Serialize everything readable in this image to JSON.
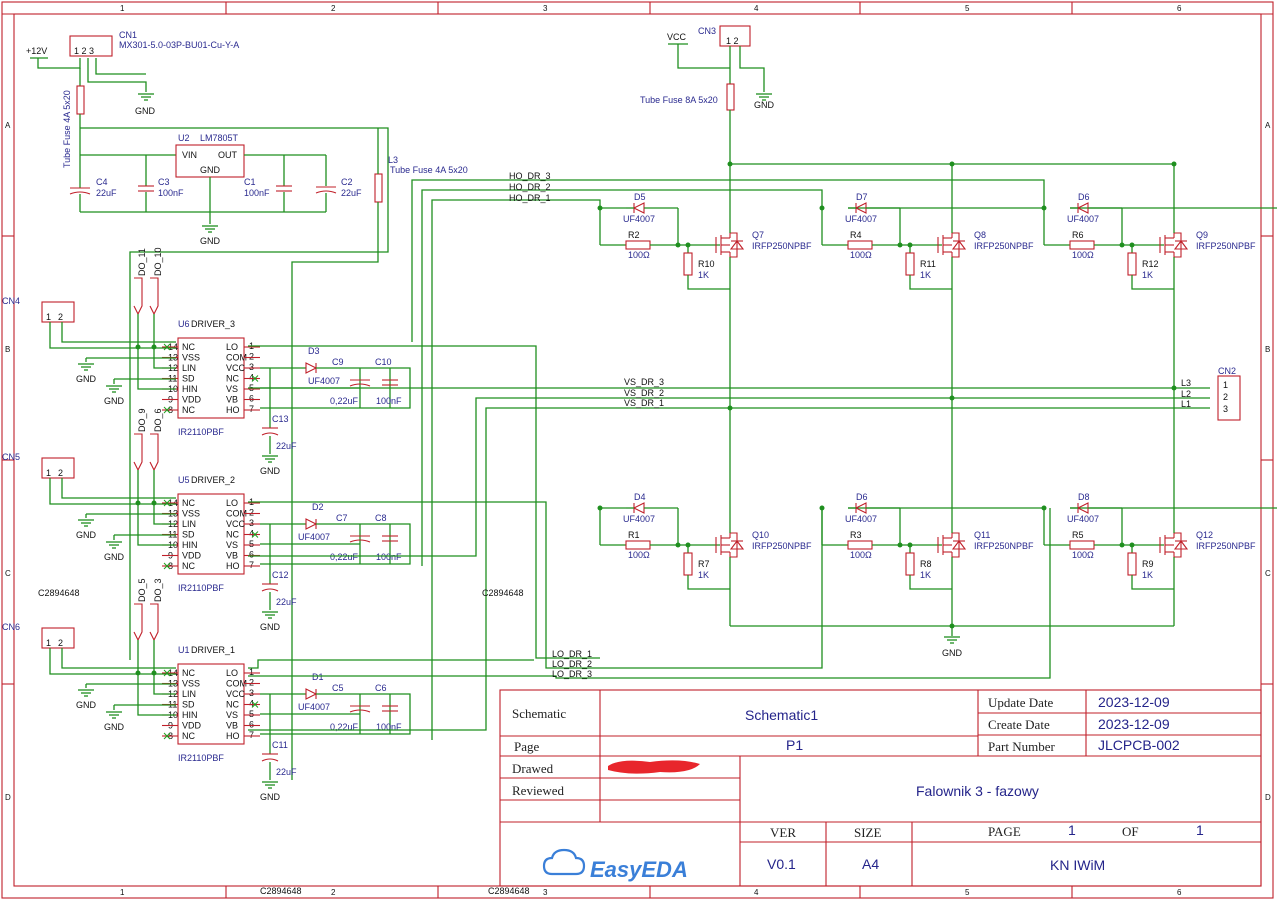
{
  "frame": {
    "cols": [
      "1",
      "2",
      "3",
      "4",
      "5",
      "6"
    ],
    "rows": [
      "A",
      "B",
      "C",
      "D"
    ]
  },
  "title_block": {
    "schematic_label": "Schematic",
    "schematic_name": "Schematic1",
    "page_label": "Page",
    "page_value": "P1",
    "update_date_label": "Update Date",
    "update_date": "2023-12-09",
    "create_date_label": "Create Date",
    "create_date": "2023-12-09",
    "part_number_label": "Part Number",
    "part_number": "JLCPCB-002",
    "drawed_label": "Drawed",
    "reviewed_label": "Reviewed",
    "project_title": "Falownik 3 - fazowy",
    "ver_label": "VER",
    "size_label": "SIZE",
    "page_hdr_label": "PAGE",
    "of_label": "OF",
    "page_num": "1",
    "page_total": "1",
    "ver_value": "V0.1",
    "size_value": "A4",
    "company": "KN IWiM",
    "logo_text": "EasyEDA"
  },
  "power": {
    "cn1": "CN1",
    "cn1_part": "MX301-5.0-03P-BU01-Cu-Y-A",
    "plus12": "+12V",
    "vcc": "VCC",
    "cn3": "CN3",
    "gnd": "GND",
    "fuse_main": "Tube Fuse 8A 5x20",
    "fuse_12v": "Tube Fuse 4A 5x20",
    "fuse_l3": "Tube Fuse 4A 5x20",
    "l3": "L3",
    "u2": "U2",
    "u2_part": "LM7805T",
    "vin": "VIN",
    "out": "OUT",
    "gnd_pin": "GND",
    "c4": "C4",
    "c4_val": "22uF",
    "c3": "C3",
    "c3_val": "100nF",
    "c1": "C1",
    "c1_val": "100nF",
    "c2": "C2",
    "c2_val": "22uF"
  },
  "nets": {
    "ho3": "HO_DR_3",
    "ho2": "HO_DR_2",
    "ho1": "HO_DR_1",
    "vs3": "VS_DR_3",
    "vs2": "VS_DR_2",
    "vs1": "VS_DR_1",
    "lo1": "LO_DR_1",
    "lo2": "LO_DR_2",
    "lo3": "LO_DR_3",
    "c28": "C2894648"
  },
  "output": {
    "cn2": "CN2",
    "l3": "L3",
    "l2": "L2",
    "l1": "L1",
    "p1": "1",
    "p2": "2",
    "p3": "3"
  },
  "drivers": [
    {
      "ref": "U6",
      "name": "DRIVER_3",
      "part": "IR2110PBF",
      "do_a": "DO_11",
      "do_b": "DO_10",
      "cn": "CN4",
      "d": "D3",
      "cb": "C9",
      "cb_val": "0,22uF",
      "cf": "C10",
      "cf_val": "100nF",
      "cbulk": "C13",
      "cbulk_val": "22uF",
      "diode": "UF4007"
    },
    {
      "ref": "U5",
      "name": "DRIVER_2",
      "part": "IR2110PBF",
      "do_a": "DO_9",
      "do_b": "DO_6",
      "cn": "CN5",
      "d": "D2",
      "cb": "C7",
      "cb_val": "0,22uF",
      "cf": "C8",
      "cf_val": "100nF",
      "cbulk": "C12",
      "cbulk_val": "22uF",
      "diode": "UF4007"
    },
    {
      "ref": "U1",
      "name": "DRIVER_1",
      "part": "IR2110PBF",
      "do_a": "DO_5",
      "do_b": "DO_3",
      "cn": "CN6",
      "d": "D1",
      "cb": "C5",
      "cb_val": "0,22uF",
      "cf": "C6",
      "cf_val": "100nF",
      "cbulk": "C11",
      "cbulk_val": "22uF",
      "diode": "UF4007"
    }
  ],
  "pins_left": [
    "NC",
    "VSS",
    "LIN",
    "SD",
    "HIN",
    "VDD",
    "NC"
  ],
  "pins_left_num": [
    "14",
    "13",
    "12",
    "11",
    "10",
    "9",
    "8"
  ],
  "pins_right": [
    "LO",
    "COM",
    "VCC",
    "NC",
    "VS",
    "VB",
    "HO"
  ],
  "pins_right_num": [
    "1",
    "2",
    "3",
    "4",
    "5",
    "6",
    "7"
  ],
  "mosfets_top": [
    {
      "d": "D5",
      "r": "R2",
      "rv": "100Ω",
      "rp": "R10",
      "rpv": "1K",
      "q": "Q7",
      "part": "IRFP250NPBF",
      "diode": "UF4007"
    },
    {
      "d": "D7",
      "r": "R4",
      "rv": "100Ω",
      "rp": "R11",
      "rpv": "1K",
      "q": "Q8",
      "part": "IRFP250NPBF",
      "diode": "UF4007"
    },
    {
      "d": "D6",
      "r": "R6",
      "rv": "100Ω",
      "rp": "R12",
      "rpv": "1K",
      "q": "Q9",
      "part": "IRFP250NPBF",
      "diode": "UF4007"
    }
  ],
  "mosfets_bottom": [
    {
      "d": "D4",
      "r": "R1",
      "rv": "100Ω",
      "rp": "R7",
      "rpv": "1K",
      "q": "Q10",
      "part": "IRFP250NPBF",
      "diode": "UF4007"
    },
    {
      "d": "D6",
      "r": "R3",
      "rv": "100Ω",
      "rp": "R8",
      "rpv": "1K",
      "q": "Q11",
      "part": "IRFP250NPBF",
      "diode": "UF4007"
    },
    {
      "d": "D8",
      "r": "R5",
      "rv": "100Ω",
      "rp": "R9",
      "rpv": "1K",
      "q": "Q12",
      "part": "IRFP250NPBF",
      "diode": "UF4007"
    }
  ],
  "connector_pins": {
    "one": "1",
    "two": "2"
  }
}
